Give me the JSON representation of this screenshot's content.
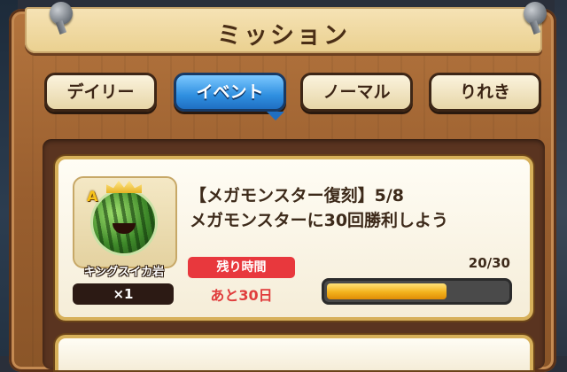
{
  "header": {
    "title": "ミッション"
  },
  "tabs": [
    {
      "label": "デイリー",
      "active": false
    },
    {
      "label": "イベント",
      "active": true
    },
    {
      "label": "ノーマル",
      "active": false
    },
    {
      "label": "りれき",
      "active": false
    }
  ],
  "mission": {
    "title": "【メガモンスター復刻】5/8",
    "description": "メガモンスターに30回勝利しよう",
    "reward": {
      "grade": "A",
      "name": "キングスイカ岩",
      "quantity": "×1",
      "icon": "king-watermelon-rock-icon"
    },
    "time_label": "残り時間",
    "time_remaining": "あと30日",
    "progress_text": "20/30",
    "progress_current": 20,
    "progress_total": 30
  },
  "colors": {
    "active_tab": "#2f8fe0",
    "time_badge": "#e8383d",
    "progress_fill": "#f3b21c"
  }
}
